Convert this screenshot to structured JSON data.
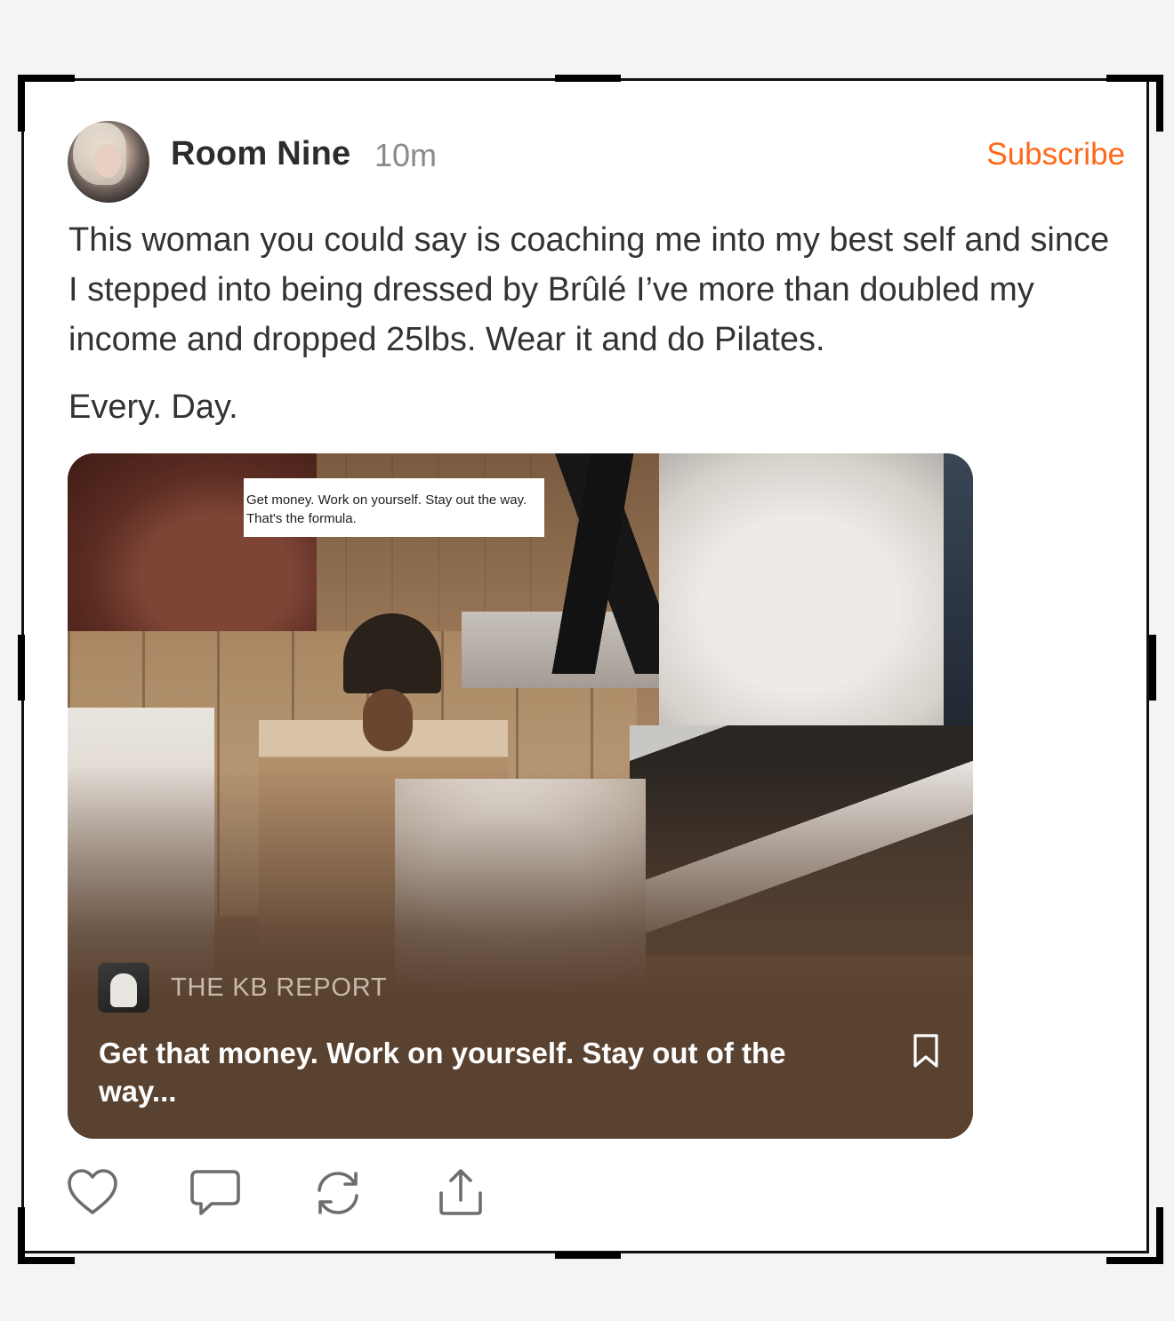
{
  "post": {
    "author": "Room Nine",
    "time": "10m",
    "subscribe_label": "Subscribe",
    "accent_color": "#ff6719",
    "body_line1": "This woman you could say is coaching me into my best self and since I stepped into being dressed by Brûlé I’ve more than doubled my income and dropped 25lbs. Wear it and do Pilates.",
    "body_line2": "Every. Day."
  },
  "embed": {
    "quote_line1": "Get money. Work on yourself. Stay out the way.",
    "quote_line2": "That's the formula.",
    "publication": "THE KB REPORT",
    "title": "Get that money. Work on yourself. Stay out of the way...",
    "card_color": "#5a4231"
  },
  "actions": {
    "icons": [
      "heart-icon",
      "comment-icon",
      "restack-icon",
      "share-icon"
    ]
  }
}
